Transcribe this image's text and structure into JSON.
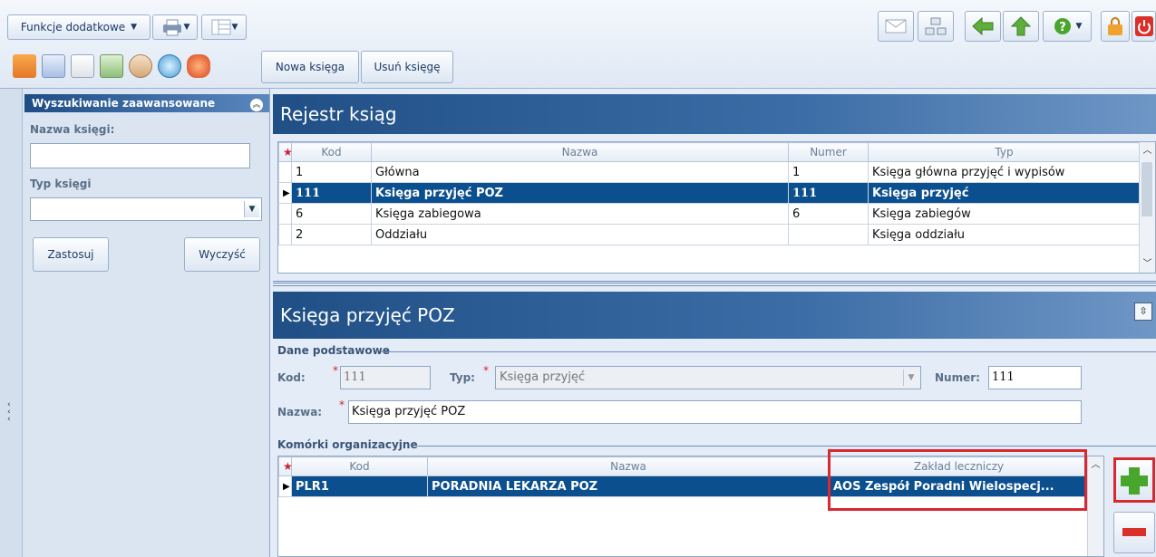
{
  "toolbar": {
    "menu_label": "Funkcje dodatkowe",
    "new_book": "Nowa księga",
    "delete_book": "Usuń księgę"
  },
  "search": {
    "title": "Wyszukiwanie zaawansowane",
    "name_label": "Nazwa księgi:",
    "name_value": "",
    "type_label": "Typ księgi",
    "type_value": "",
    "apply": "Zastosuj",
    "clear": "Wyczyść"
  },
  "register": {
    "title": "Rejestr ksiąg",
    "columns": [
      "Kod",
      "Nazwa",
      "Numer",
      "Typ"
    ],
    "rows": [
      {
        "kod": "1",
        "nazwa": "Główna",
        "numer": "1",
        "typ": "Księga główna przyjęć i wypisów"
      },
      {
        "kod": "111",
        "nazwa": "Księga przyjęć POZ",
        "numer": "111",
        "typ": "Księga przyjęć"
      },
      {
        "kod": "6",
        "nazwa": "Księga zabiegowa",
        "numer": "6",
        "typ": "Księga zabiegów"
      },
      {
        "kod": "2",
        "nazwa": "Oddziału",
        "numer": "",
        "typ": "Księga oddziału"
      }
    ]
  },
  "detail": {
    "title": "Księga przyjęć POZ",
    "section_basic": "Dane podstawowe",
    "kod_label": "Kod:",
    "kod_value": "111",
    "typ_label": "Typ:",
    "typ_value": "Księga przyjęć",
    "numer_label": "Numer:",
    "numer_value": "111",
    "nazwa_label": "Nazwa:",
    "nazwa_value": "Księga przyjęć POZ",
    "section_units": "Komórki organizacyjne",
    "unit_columns": [
      "Kod",
      "Nazwa",
      "Zakład leczniczy"
    ],
    "unit_rows": [
      {
        "kod": "PLR1",
        "nazwa": "PORADNIA LEKARZA POZ",
        "zaklad": "AOS Zespół Poradni Wielospecj..."
      }
    ]
  },
  "colors": {
    "selection": "#0c4f8e",
    "highlight": "#d9282f",
    "header_band": "#1f4f85"
  }
}
